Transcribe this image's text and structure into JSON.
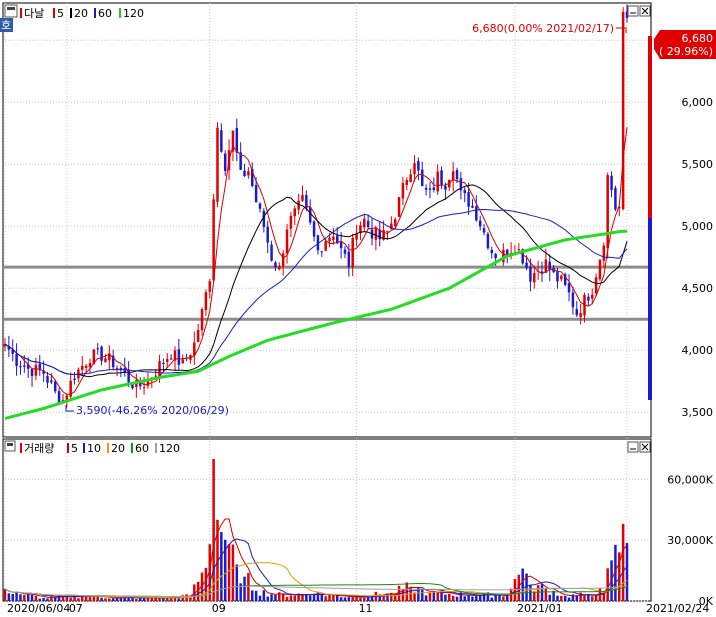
{
  "price_panel": {
    "legend_title": "다날",
    "ma_legend": [
      {
        "label": "5",
        "color": "#d40000"
      },
      {
        "label": "20",
        "color": "#000000"
      },
      {
        "label": "60",
        "color": "#1a1ad0"
      },
      {
        "label": "120",
        "color": "#22cc22"
      }
    ],
    "high_annotation": "6,680(0.00% 2021/02/17)",
    "low_annotation": "3,590(-46.26% 2020/06/29)",
    "last_price_badge": "6,680",
    "last_change_badge": "( 29.96%)"
  },
  "volume_panel": {
    "legend_title": "거래량",
    "ma_legend": [
      {
        "label": "5",
        "color": "#d40000"
      },
      {
        "label": "10",
        "color": "#1a1ad0"
      },
      {
        "label": "20",
        "color": "#e0a000"
      },
      {
        "label": "60",
        "color": "#1a8a1a"
      },
      {
        "label": "120",
        "color": "#a0a0a0"
      }
    ]
  },
  "colors": {
    "up": "#e00000",
    "down": "#1a1ad0",
    "ma120": "#22dd22",
    "support": "#8c8c8c"
  },
  "chart_data": [
    {
      "type": "candlestick",
      "title": "다날",
      "y_ticks": [
        "3,500",
        "4,000",
        "4,500",
        "5,000",
        "5,500",
        "6,000",
        "6,500"
      ],
      "y_tick_values": [
        3500,
        4000,
        4500,
        5000,
        5500,
        6000,
        6500
      ],
      "ylim": [
        3300,
        6800
      ],
      "x_labels": [
        "2020/06/04",
        "07",
        "09",
        "11",
        "2021/01",
        "2021/02/24"
      ],
      "x_label_index": [
        0,
        16,
        53,
        91,
        132,
        161
      ],
      "n_sessions": 162,
      "support_lines": [
        4670,
        4250
      ],
      "price_anchors": [
        {
          "index": 0,
          "close": 4050
        },
        {
          "index": 3,
          "close": 3920
        },
        {
          "index": 6,
          "close": 3850
        },
        {
          "index": 10,
          "close": 3820
        },
        {
          "index": 13,
          "close": 3650
        },
        {
          "index": 15,
          "close": 3600
        },
        {
          "index": 18,
          "close": 3800
        },
        {
          "index": 22,
          "close": 3950
        },
        {
          "index": 25,
          "close": 3960
        },
        {
          "index": 28,
          "close": 3900
        },
        {
          "index": 31,
          "close": 3800
        },
        {
          "index": 34,
          "close": 3700
        },
        {
          "index": 37,
          "close": 3750
        },
        {
          "index": 40,
          "close": 3880
        },
        {
          "index": 43,
          "close": 3980
        },
        {
          "index": 46,
          "close": 3880
        },
        {
          "index": 49,
          "close": 4050
        },
        {
          "index": 51,
          "close": 4300
        },
        {
          "index": 53,
          "close": 4600
        },
        {
          "index": 54,
          "close": 5250
        },
        {
          "index": 55,
          "close": 5800
        },
        {
          "index": 57,
          "close": 5500
        },
        {
          "index": 59,
          "close": 5750
        },
        {
          "index": 61,
          "close": 5400
        },
        {
          "index": 63,
          "close": 5450
        },
        {
          "index": 65,
          "close": 5200
        },
        {
          "index": 67,
          "close": 5000
        },
        {
          "index": 69,
          "close": 4750
        },
        {
          "index": 71,
          "close": 4650
        },
        {
          "index": 73,
          "close": 5000
        },
        {
          "index": 75,
          "close": 5100
        },
        {
          "index": 77,
          "close": 5200
        },
        {
          "index": 79,
          "close": 5000
        },
        {
          "index": 81,
          "close": 4800
        },
        {
          "index": 83,
          "close": 4900
        },
        {
          "index": 85,
          "close": 4950
        },
        {
          "index": 87,
          "close": 4800
        },
        {
          "index": 89,
          "close": 4700
        },
        {
          "index": 91,
          "close": 5000
        },
        {
          "index": 93,
          "close": 5050
        },
        {
          "index": 95,
          "close": 4950
        },
        {
          "index": 97,
          "close": 4900
        },
        {
          "index": 99,
          "close": 4950
        },
        {
          "index": 101,
          "close": 5100
        },
        {
          "index": 104,
          "close": 5400
        },
        {
          "index": 106,
          "close": 5550
        },
        {
          "index": 108,
          "close": 5300
        },
        {
          "index": 110,
          "close": 5250
        },
        {
          "index": 112,
          "close": 5400
        },
        {
          "index": 114,
          "close": 5350
        },
        {
          "index": 116,
          "close": 5500
        },
        {
          "index": 118,
          "close": 5250
        },
        {
          "index": 120,
          "close": 5200
        },
        {
          "index": 122,
          "close": 5100
        },
        {
          "index": 124,
          "close": 4950
        },
        {
          "index": 126,
          "close": 4800
        },
        {
          "index": 128,
          "close": 4750
        },
        {
          "index": 130,
          "close": 4800
        },
        {
          "index": 132,
          "close": 4850
        },
        {
          "index": 134,
          "close": 4750
        },
        {
          "index": 136,
          "close": 4600
        },
        {
          "index": 138,
          "close": 4650
        },
        {
          "index": 140,
          "close": 4700
        },
        {
          "index": 142,
          "close": 4600
        },
        {
          "index": 144,
          "close": 4550
        },
        {
          "index": 146,
          "close": 4450
        },
        {
          "index": 148,
          "close": 4300
        },
        {
          "index": 150,
          "close": 4400
        },
        {
          "index": 152,
          "close": 4500
        },
        {
          "index": 154,
          "close": 4750
        },
        {
          "index": 155,
          "close": 4900
        },
        {
          "index": 156,
          "close": 5400
        },
        {
          "index": 157,
          "close": 5300
        },
        {
          "index": 158,
          "close": 5150
        },
        {
          "index": 159,
          "close": 5150
        },
        {
          "index": 160,
          "close": 6680
        }
      ],
      "ma120_anchors": [
        {
          "index": 0,
          "value": 3450
        },
        {
          "index": 10,
          "value": 3530
        },
        {
          "index": 25,
          "value": 3680
        },
        {
          "index": 40,
          "value": 3780
        },
        {
          "index": 50,
          "value": 3830
        },
        {
          "index": 58,
          "value": 3950
        },
        {
          "index": 68,
          "value": 4080
        },
        {
          "index": 85,
          "value": 4220
        },
        {
          "index": 100,
          "value": 4330
        },
        {
          "index": 115,
          "value": 4500
        },
        {
          "index": 130,
          "value": 4760
        },
        {
          "index": 145,
          "value": 4890
        },
        {
          "index": 160,
          "value": 4960
        }
      ]
    },
    {
      "type": "bar",
      "title": "거래량",
      "y_ticks": [
        "0K",
        "30,000K",
        "60,000K"
      ],
      "y_tick_values": [
        0,
        30000,
        60000
      ],
      "ylim": [
        0,
        72000
      ],
      "volume_anchors": [
        {
          "index": 0,
          "value": 6000
        },
        {
          "index": 5,
          "value": 3000
        },
        {
          "index": 10,
          "value": 1500
        },
        {
          "index": 20,
          "value": 2500
        },
        {
          "index": 30,
          "value": 1500
        },
        {
          "index": 40,
          "value": 1500
        },
        {
          "index": 48,
          "value": 2500
        },
        {
          "index": 51,
          "value": 14000
        },
        {
          "index": 53,
          "value": 28000
        },
        {
          "index": 54,
          "value": 70000
        },
        {
          "index": 55,
          "value": 40000
        },
        {
          "index": 56,
          "value": 34000
        },
        {
          "index": 58,
          "value": 28000
        },
        {
          "index": 60,
          "value": 18000
        },
        {
          "index": 62,
          "value": 12000
        },
        {
          "index": 65,
          "value": 5000
        },
        {
          "index": 70,
          "value": 3000
        },
        {
          "index": 80,
          "value": 3500
        },
        {
          "index": 90,
          "value": 2000
        },
        {
          "index": 100,
          "value": 4000
        },
        {
          "index": 105,
          "value": 7000
        },
        {
          "index": 110,
          "value": 4000
        },
        {
          "index": 120,
          "value": 3000
        },
        {
          "index": 130,
          "value": 3000
        },
        {
          "index": 134,
          "value": 16000
        },
        {
          "index": 136,
          "value": 8000
        },
        {
          "index": 140,
          "value": 6000
        },
        {
          "index": 145,
          "value": 2500
        },
        {
          "index": 150,
          "value": 3000
        },
        {
          "index": 155,
          "value": 5000
        },
        {
          "index": 157,
          "value": 20000
        },
        {
          "index": 159,
          "value": 24000
        },
        {
          "index": 160,
          "value": 38000
        }
      ]
    }
  ]
}
